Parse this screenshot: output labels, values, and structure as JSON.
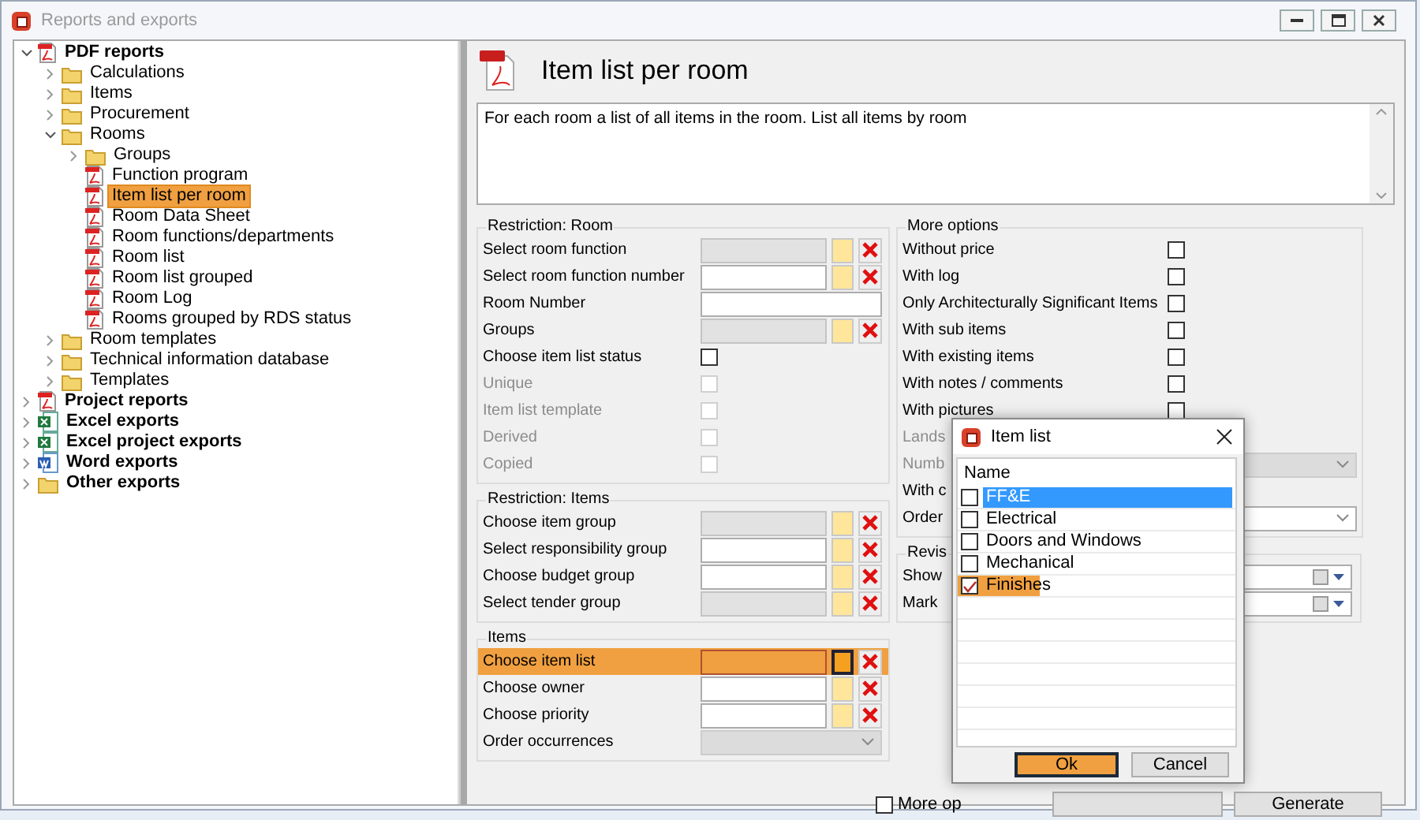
{
  "window": {
    "title": "Reports and exports"
  },
  "tree": [
    {
      "label": "PDF reports",
      "kind": "pdf",
      "expanded": true,
      "selected": false,
      "children": [
        {
          "label": "Calculations",
          "kind": "folder",
          "expanded": false,
          "selected": false
        },
        {
          "label": "Items",
          "kind": "folder",
          "expanded": false,
          "selected": false
        },
        {
          "label": "Procurement",
          "kind": "folder",
          "expanded": false,
          "selected": false
        },
        {
          "label": "Rooms",
          "kind": "folder",
          "expanded": true,
          "selected": false,
          "children": [
            {
              "label": "Groups",
              "kind": "folder",
              "expanded": false,
              "selected": false
            },
            {
              "label": "Function program",
              "kind": "pdf",
              "selected": false
            },
            {
              "label": "Item list per room",
              "kind": "pdf",
              "selected": true
            },
            {
              "label": "Room Data Sheet",
              "kind": "pdf",
              "selected": false
            },
            {
              "label": "Room functions/departments",
              "kind": "pdf",
              "selected": false
            },
            {
              "label": "Room list",
              "kind": "pdf",
              "selected": false
            },
            {
              "label": "Room list grouped",
              "kind": "pdf",
              "selected": false
            },
            {
              "label": "Room Log",
              "kind": "pdf",
              "selected": false
            },
            {
              "label": "Rooms grouped by RDS status",
              "kind": "pdf",
              "selected": false
            }
          ]
        },
        {
          "label": "Room templates",
          "kind": "folder",
          "expanded": false,
          "selected": false
        },
        {
          "label": "Technical information database",
          "kind": "folder",
          "expanded": false,
          "selected": false
        },
        {
          "label": "Templates",
          "kind": "folder",
          "expanded": false,
          "selected": false
        }
      ]
    },
    {
      "label": "Project reports",
      "kind": "pdf",
      "expanded": false,
      "selected": false
    },
    {
      "label": "Excel exports",
      "kind": "excel",
      "expanded": false,
      "selected": false
    },
    {
      "label": "Excel project exports",
      "kind": "excel",
      "expanded": false,
      "selected": false
    },
    {
      "label": "Word exports",
      "kind": "word",
      "expanded": false,
      "selected": false
    },
    {
      "label": "Other exports",
      "kind": "folder",
      "expanded": false,
      "selected": false
    }
  ],
  "report": {
    "title": "Item list per room",
    "description": "For each room a list of all items in the room. List all items by room"
  },
  "restriction_room": {
    "legend": "Restriction: Room",
    "rows": [
      {
        "kind": "picker",
        "label": "Select room function",
        "readonly": true,
        "highlighted": false
      },
      {
        "kind": "picker",
        "label": "Select room function number",
        "readonly": false,
        "highlighted": false
      },
      {
        "kind": "text",
        "label": "Room Number"
      },
      {
        "kind": "picker",
        "label": "Groups",
        "readonly": true,
        "highlighted": false
      },
      {
        "kind": "checkbox",
        "label": "Choose item list status",
        "checked": false,
        "disabled": false
      },
      {
        "kind": "checkbox",
        "label": "Unique",
        "checked": false,
        "disabled": true
      },
      {
        "kind": "checkbox",
        "label": "Item list template",
        "checked": false,
        "disabled": true
      },
      {
        "kind": "checkbox",
        "label": "Derived",
        "checked": false,
        "disabled": true
      },
      {
        "kind": "checkbox",
        "label": "Copied",
        "checked": false,
        "disabled": true
      }
    ]
  },
  "restriction_items": {
    "legend": "Restriction: Items",
    "rows": [
      {
        "kind": "picker",
        "label": "Choose item group",
        "readonly": true,
        "highlighted": false
      },
      {
        "kind": "picker",
        "label": "Select responsibility group",
        "readonly": false,
        "highlighted": false
      },
      {
        "kind": "picker",
        "label": "Choose budget group",
        "readonly": false,
        "highlighted": false
      },
      {
        "kind": "picker",
        "label": "Select tender group",
        "readonly": true,
        "highlighted": false
      }
    ]
  },
  "items": {
    "legend": "Items",
    "rows": [
      {
        "kind": "picker",
        "label": "Choose item list",
        "readonly": false,
        "highlighted": true
      },
      {
        "kind": "picker",
        "label": "Choose owner",
        "readonly": false,
        "highlighted": false
      },
      {
        "kind": "picker",
        "label": "Choose priority",
        "readonly": false,
        "highlighted": false
      },
      {
        "kind": "combo",
        "label": "Order occurrences",
        "disabled": true
      }
    ]
  },
  "more_options": {
    "legend": "More options",
    "rows": [
      {
        "kind": "checkbox",
        "label": "Without price",
        "checked": false,
        "disabled": false
      },
      {
        "kind": "checkbox",
        "label": "With log",
        "checked": false,
        "disabled": false
      },
      {
        "kind": "checkbox",
        "label": "Only Architecturally Significant Items",
        "checked": false,
        "disabled": false
      },
      {
        "kind": "checkbox",
        "label": "With sub items",
        "checked": false,
        "disabled": false
      },
      {
        "kind": "checkbox",
        "label": "With existing items",
        "checked": false,
        "disabled": false
      },
      {
        "kind": "checkbox",
        "label": "With notes / comments",
        "checked": false,
        "disabled": false
      },
      {
        "kind": "checkbox",
        "label": "With pictures",
        "checked": false,
        "disabled": false
      },
      {
        "kind": "label",
        "label": "Lands",
        "disabled": true
      },
      {
        "kind": "combo",
        "label": "Numb",
        "disabled": true
      },
      {
        "kind": "label",
        "label": "With c",
        "disabled": false
      },
      {
        "kind": "combo",
        "label": "Order",
        "disabled": false
      }
    ]
  },
  "revisions": {
    "legend": "Revis",
    "rows": [
      {
        "kind": "date",
        "label": "Show"
      },
      {
        "kind": "date",
        "label": "Mark"
      }
    ]
  },
  "footer": {
    "more_options": {
      "label": "More op",
      "checked": false
    },
    "buttons": [
      {
        "kind": "covered"
      },
      {
        "kind": "plain",
        "label": "Generate"
      }
    ]
  },
  "dialog": {
    "title": "Item list",
    "column": "Name",
    "rows": [
      {
        "label": "FF&E",
        "checked": false,
        "selected": true,
        "highlighted": false
      },
      {
        "label": "Electrical",
        "checked": false,
        "selected": false,
        "highlighted": false
      },
      {
        "label": "Doors and Windows",
        "checked": false,
        "selected": false,
        "highlighted": false
      },
      {
        "label": "Mechanical",
        "checked": false,
        "selected": false,
        "highlighted": false
      },
      {
        "label": "Finishes",
        "checked": true,
        "selected": false,
        "highlighted": true
      }
    ],
    "buttons": [
      {
        "label": "Ok",
        "highlighted": true
      },
      {
        "label": "Cancel",
        "highlighted": false
      }
    ]
  }
}
